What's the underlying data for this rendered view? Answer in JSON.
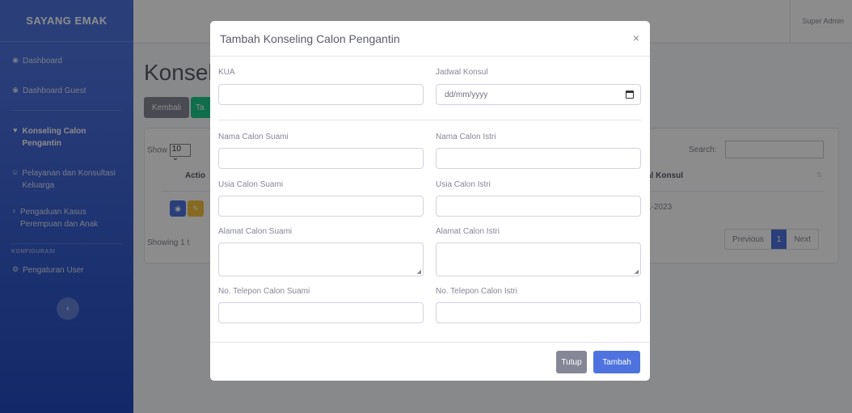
{
  "sidebar": {
    "brand": "SAYANG EMAK",
    "items": [
      {
        "label": "Dashboard",
        "icon": "tachometer-icon"
      },
      {
        "label": "Dashboard Guest",
        "icon": "tachometer-icon"
      },
      {
        "label": "Konseling Calon Pengantin",
        "icon": "couple-icon",
        "active": true
      },
      {
        "label": "Pelayanan dan Konsultasi Keluarga",
        "icon": "users-icon"
      },
      {
        "label": "Pengaduan Kasus Perempuan dan Anak",
        "icon": "person-icon"
      }
    ],
    "section_heading": "KONFIGURASI",
    "config_items": [
      {
        "label": "Pengaturan User",
        "icon": "cogs-icon"
      }
    ]
  },
  "topbar": {
    "user": "Super Admin"
  },
  "main": {
    "title": "Konsel",
    "back_button": "Kembali",
    "add_button": "Ta",
    "table": {
      "show_label": "Show",
      "show_value": "10",
      "search_label": "Search:",
      "col_action": "Actio",
      "col_date": "al Konsul",
      "row_date": "1-2023",
      "showing": "Showing 1 t",
      "pager": {
        "prev": "Previous",
        "current": "1",
        "next": "Next"
      }
    }
  },
  "modal": {
    "title": "Tambah Konseling Calon Pengantin",
    "close": "×",
    "fields": {
      "kua": "KUA",
      "jadwal": "Jadwal Konsul",
      "jadwal_placeholder": "dd/mm/yyyy",
      "nama_suami": "Nama Calon Suami",
      "nama_istri": "Nama Calon Istri",
      "usia_suami": "Usia Calon Suami",
      "usia_istri": "Usia Calon Istri",
      "alamat_suami": "Alamat Calon Suami",
      "alamat_istri": "Alamat Calon Istri",
      "telp_suami": "No. Telepon Calon Suami",
      "telp_istri": "No. Telepon Calon Istri"
    },
    "buttons": {
      "close": "Tutup",
      "submit": "Tambah"
    }
  },
  "colors": {
    "primary": "#4e73df",
    "secondary": "#858796",
    "success": "#1cc88a",
    "warning": "#f6c23e"
  }
}
